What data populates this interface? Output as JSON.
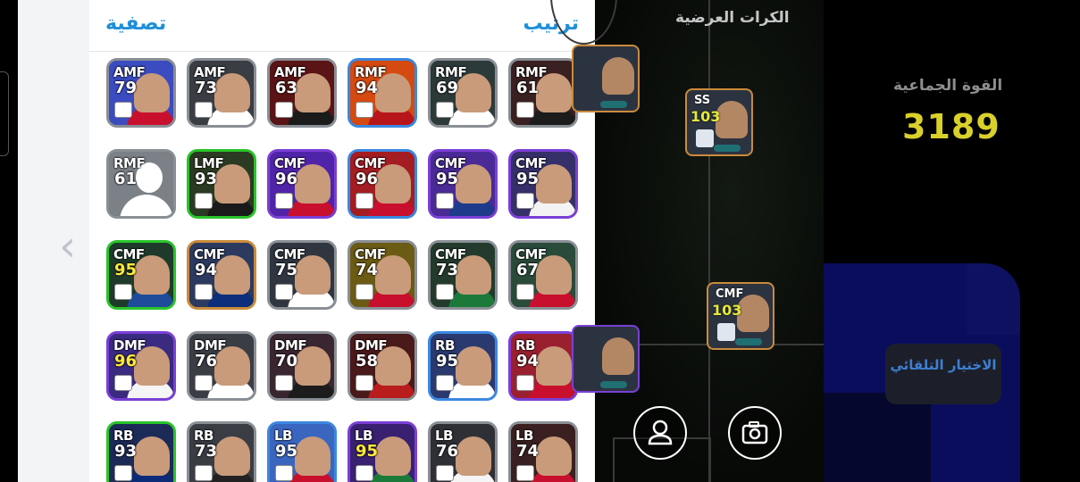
{
  "panel": {
    "filter_label": "تصفية",
    "sort_label": "ترتيب"
  },
  "field": {
    "title": "الكرات العرضية"
  },
  "team": {
    "power_label": "القوة الجماعية",
    "power_value": "3189"
  },
  "auto_select_label": "الاختيار التلقائي",
  "cards": [
    {
      "pos": "AMF",
      "rating": "79",
      "gold": false,
      "border": "#8a8f96",
      "bg": "#3b4cc0",
      "shirt": "#c8102e"
    },
    {
      "pos": "AMF",
      "rating": "73",
      "gold": false,
      "border": "#8a8f96",
      "bg": "#3a3d44",
      "shirt": "#ffffff"
    },
    {
      "pos": "AMF",
      "rating": "63",
      "gold": false,
      "border": "#8a8f96",
      "bg": "#5a1416",
      "shirt": "#1b1b1b"
    },
    {
      "pos": "RMF",
      "rating": "94",
      "gold": false,
      "border": "#3b88e0",
      "bg": "#d44a10",
      "shirt": "#b8151b"
    },
    {
      "pos": "RMF",
      "rating": "69",
      "gold": false,
      "border": "#8a8f96",
      "bg": "#2d3a3a",
      "shirt": "#ffffff"
    },
    {
      "pos": "RMF",
      "rating": "61",
      "gold": false,
      "border": "#8a8f96",
      "bg": "#3a2020",
      "shirt": "#1c1c1c"
    },
    {
      "pos": "RMF",
      "rating": "61",
      "gold": false,
      "border": "#8a8f96",
      "bg": "#7c8188",
      "shirt": "#ffffff",
      "placeholder": true
    },
    {
      "pos": "LMF",
      "rating": "93",
      "gold": false,
      "border": "#29c42a",
      "bg": "#2b3a22",
      "shirt": "#1a1a1a"
    },
    {
      "pos": "CMF",
      "rating": "96",
      "gold": false,
      "border": "#7a3fd6",
      "bg": "#5024a8",
      "shirt": "#c8102e"
    },
    {
      "pos": "CMF",
      "rating": "96",
      "gold": false,
      "border": "#3b88e0",
      "bg": "#a41d22",
      "shirt": "#c8102e"
    },
    {
      "pos": "CMF",
      "rating": "95",
      "gold": false,
      "border": "#7a3fd6",
      "bg": "#4a2a96",
      "shirt": "#1e3a8a"
    },
    {
      "pos": "CMF",
      "rating": "95",
      "gold": false,
      "border": "#7a3fd6",
      "bg": "#36306a",
      "shirt": "#f3f3f3"
    },
    {
      "pos": "CMF",
      "rating": "95",
      "gold": true,
      "border": "#29c42a",
      "bg": "#1f3a2a",
      "shirt": "#1e4c9a"
    },
    {
      "pos": "CMF",
      "rating": "94",
      "gold": false,
      "border": "#c98b3b",
      "bg": "#2c3a60",
      "shirt": "#0d2e7a"
    },
    {
      "pos": "CMF",
      "rating": "75",
      "gold": false,
      "border": "#8a8f96",
      "bg": "#2f3640",
      "shirt": "#ffffff"
    },
    {
      "pos": "CMF",
      "rating": "74",
      "gold": false,
      "border": "#8a8f96",
      "bg": "#6b5b14",
      "shirt": "#c8102e"
    },
    {
      "pos": "CMF",
      "rating": "73",
      "gold": false,
      "border": "#8a8f96",
      "bg": "#243a2c",
      "shirt": "#1b7a3a"
    },
    {
      "pos": "CMF",
      "rating": "67",
      "gold": false,
      "border": "#8a8f96",
      "bg": "#2a4a3a",
      "shirt": "#c8102e"
    },
    {
      "pos": "DMF",
      "rating": "96",
      "gold": true,
      "border": "#7a3fd6",
      "bg": "#3a2a80",
      "shirt": "#f5f5f5"
    },
    {
      "pos": "DMF",
      "rating": "76",
      "gold": false,
      "border": "#8a8f96",
      "bg": "#3a3d44",
      "shirt": "#ffffff"
    },
    {
      "pos": "DMF",
      "rating": "70",
      "gold": false,
      "border": "#8a8f96",
      "bg": "#3a2630",
      "shirt": "#1c1c1c"
    },
    {
      "pos": "DMF",
      "rating": "58",
      "gold": false,
      "border": "#8a8f96",
      "bg": "#4a1a1a",
      "shirt": "#b81c1c"
    },
    {
      "pos": "RB",
      "rating": "95",
      "gold": false,
      "border": "#3b88e0",
      "bg": "#2a3a70",
      "shirt": "#ffffff"
    },
    {
      "pos": "RB",
      "rating": "94",
      "gold": false,
      "border": "#7a3fd6",
      "bg": "#9a2030",
      "shirt": "#c8102e"
    },
    {
      "pos": "RB",
      "rating": "93",
      "gold": false,
      "border": "#29c42a",
      "bg": "#1c2a58",
      "shirt": "#0b2a78"
    },
    {
      "pos": "RB",
      "rating": "73",
      "gold": false,
      "border": "#8a8f96",
      "bg": "#3a3d44",
      "shirt": "#222222"
    },
    {
      "pos": "LB",
      "rating": "95",
      "gold": false,
      "border": "#3b88e0",
      "bg": "#3a66c0",
      "shirt": "#c8102e"
    },
    {
      "pos": "LB",
      "rating": "95",
      "gold": true,
      "border": "#7a3fd6",
      "bg": "#3a2070",
      "shirt": "#1b7a3a"
    },
    {
      "pos": "LB",
      "rating": "76",
      "gold": false,
      "border": "#8a8f96",
      "bg": "#2f3036",
      "shirt": "#f5f5f5"
    },
    {
      "pos": "LB",
      "rating": "74",
      "gold": false,
      "border": "#8a8f96",
      "bg": "#3a2020",
      "shirt": "#c8102e"
    }
  ],
  "field_cards": [
    {
      "pos": "SS",
      "rating": "103"
    },
    {
      "pos": "CMF",
      "rating": "103"
    }
  ],
  "icons": {
    "left_arrow": "chevron-left-icon",
    "profile": "person-icon",
    "camera": "camera-icon"
  }
}
